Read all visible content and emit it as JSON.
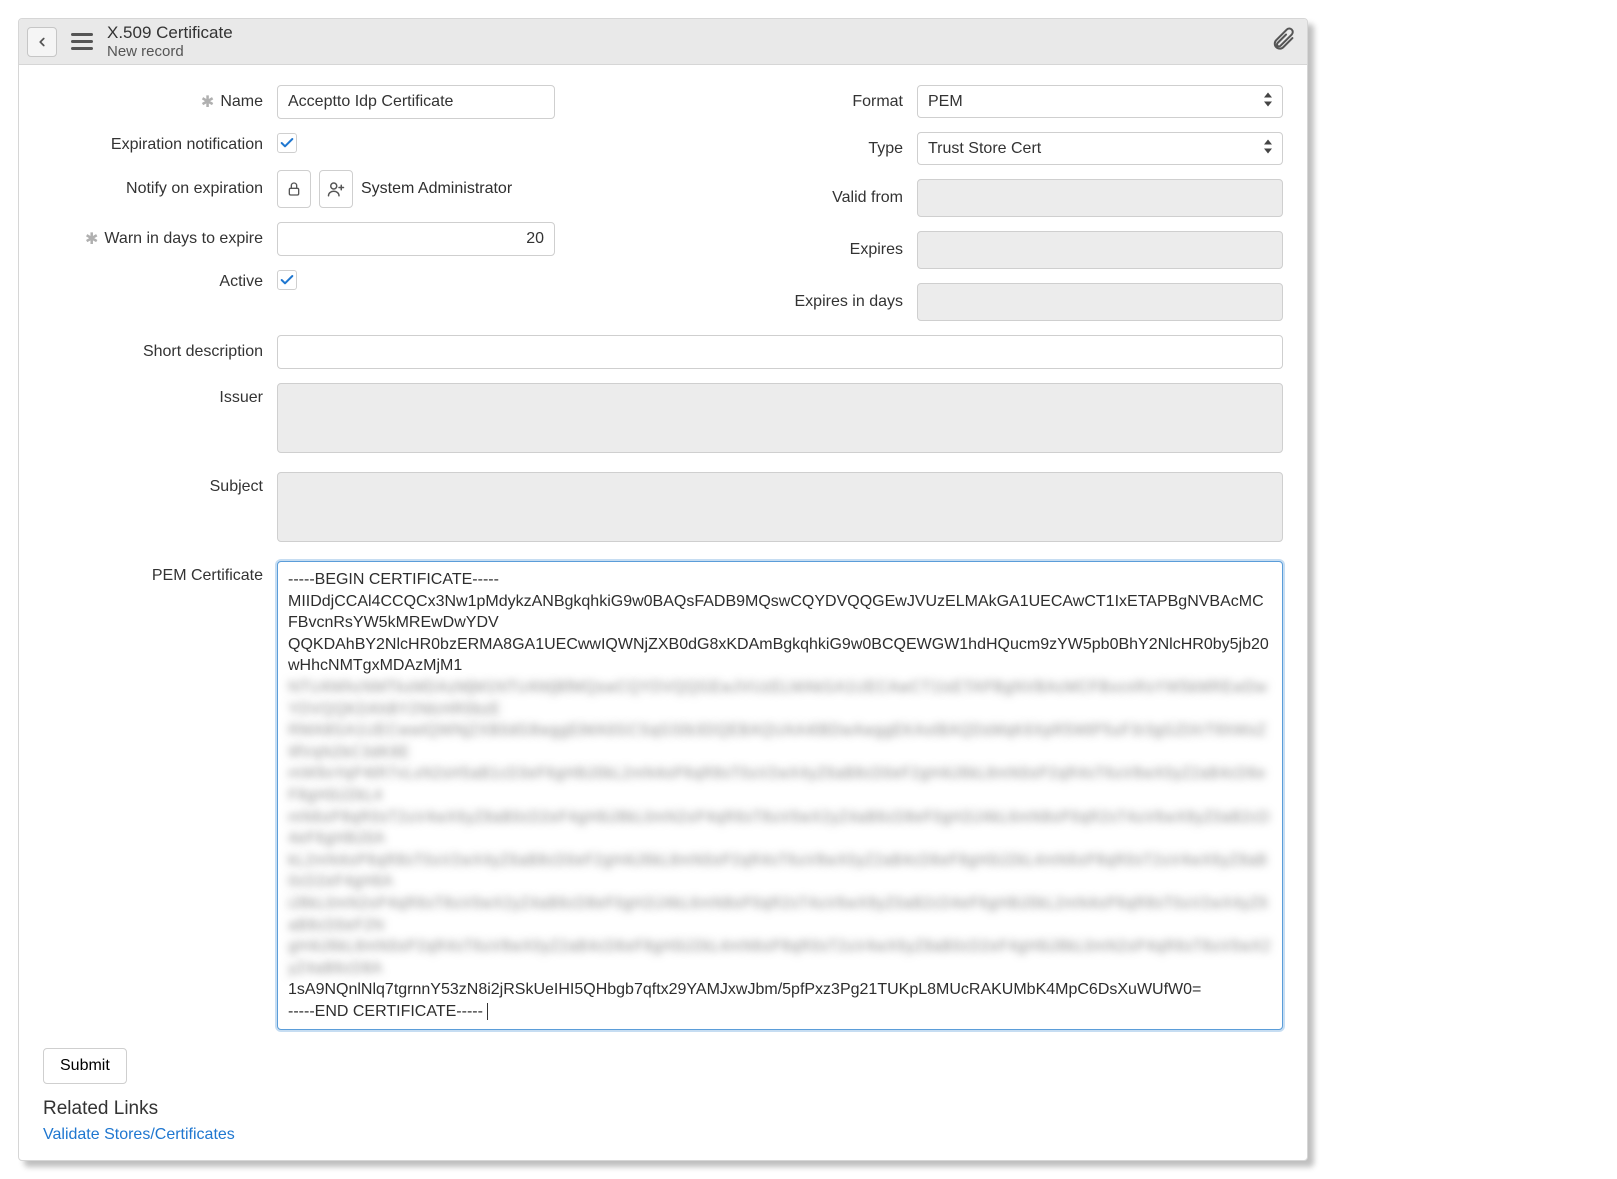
{
  "header": {
    "title": "X.509 Certificate",
    "subtitle": "New record"
  },
  "labels": {
    "name": "Name",
    "expiration_notification": "Expiration notification",
    "notify_on_expiration": "Notify on expiration",
    "warn_days": "Warn in days to expire",
    "active": "Active",
    "short_description": "Short description",
    "issuer": "Issuer",
    "subject": "Subject",
    "pem_certificate": "PEM Certificate",
    "format": "Format",
    "type": "Type",
    "valid_from": "Valid from",
    "expires": "Expires",
    "expires_in_days": "Expires in days"
  },
  "values": {
    "name": "Acceptto Idp Certificate",
    "expiration_notification": true,
    "notify_on_expiration": "System Administrator",
    "warn_days": "20",
    "active": true,
    "short_description": "",
    "issuer": "",
    "subject": "",
    "format": "PEM",
    "type": "Trust Store Cert",
    "valid_from": "",
    "expires": "",
    "expires_in_days": "",
    "pem_begin": "-----BEGIN CERTIFICATE-----",
    "pem_line1": "MIIDdjCCAl4CCQCx3Nw1pMdykzANBgkqhkiG9w0BAQsFADB9MQswCQYDVQQGEwJVUzELMAkGA1UECAwCT1IxETAPBgNVBAcMCFBvcnRsYW5kMREwDwYDV",
    "pem_line2": "QQKDAhBY2NlcHR0bzERMA8GA1UECwwIQWNjZXB0dG8xKDAmBgkqhkiG9w0BCQEWGW1hdHQucm9zYW5pb0BhY2NlcHR0by5jb20wHhcNMTgxMDAzMjM1",
    "pem_blur1": "NTU4WhcNMTkxMDAzMjM1NTU4WjBfMQswCQYDVQQGEwJVUzELMAkGA1UECAwCT1IxETAPBgNVBAcMCFBvcnRsYW5kMREwDwYDVQQKDAhBY2NlcHR0bzE",
    "pem_blur2": "RMA8GA1UECwwIQWNjZXB0dG8wggEiMA0GCSqGSIb3DQEBAQUAA4IBDwAwggEKAoIBAQDsMqK6XpR5WtP5uF3r3gGZtXrT6hWoZ9fVqN2bC3dK8E",
    "pem_blur3": "mW9oYqP4tR7vLxN2sH5aB1cD3eF6gH8iJ0kL2mN4oP6qR8sT0uV2wX4yZ6aB8cD0eF2gH4iJ6kL8mN0oP2qR4sT6uV8wX0yZ2aB4cD6eF8gH0iJ2kL4",
    "pem_blur4": "mN6oP8qR0sT2uV4wX6yZ8aB0cD2eF4gH6iJ8kL0mN2oP4qR6sT8uV0wX2yZ4aB6cD8eF0gH2iJ4kL6mN8oP0qR2sT4uV6wX8yZ0aB2cD4eF6gH8iJ0A",
    "pem_blur5": "kL2mN4oP6qR8sT0uV2wX4yZ6aB8cD0eF2gH4iJ6kL8mN0oP2qR4sT6uV8wX0yZ2aB4cD6eF8gH0iJ2kL4mN6oP8qR0sT2uV4wX6yZ8aB0cD2eF4gH6A",
    "pem_blur6": "iJ8kL0mN2oP4qR6sT8uV0wX2yZ4aB6cD8eF0gH2iJ4kL6mN8oP0qR2sT4uV6wX8yZ0aB2cD4eF6gH8iJ0kL2mN4oP6qR8sT0uV2wX4yZ6aB8cD0eF2N",
    "pem_blur7": "gH4iJ6kL8mN0oP2qR4sT6uV8wX0yZ2aB4cD6eF8gH0iJ2kL4mN6oP8qR0sT2uV4wX6yZ8aB0cD2eF4gH6iJ8kL0mN2oP4qR6sT8uV0wX2yZ4aB6cD8A",
    "pem_line3": "1sA9NQnlNlq7tgrnnY53zN8i2jRSkUeIHI5QHbgb7qftx29YAMJxwJbm/5pfPxz3Pg21TUKpL8MUcRAKUMbK4MpC6DsXuWUfW0=",
    "pem_end": "-----END CERTIFICATE-----"
  },
  "actions": {
    "submit": "Submit"
  },
  "related": {
    "heading": "Related Links",
    "validate": "Validate Stores/Certificates"
  }
}
